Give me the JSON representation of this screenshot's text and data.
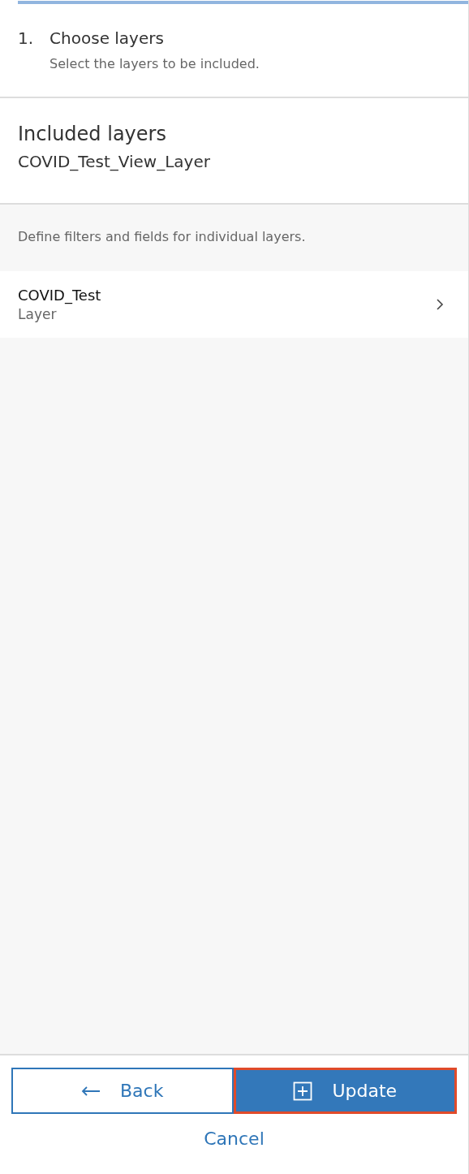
{
  "step": {
    "number": "1.",
    "title": "Choose layers",
    "subtitle": "Select the layers to be included."
  },
  "included": {
    "title": "Included layers",
    "value": "COVID_Test_View_Layer"
  },
  "layers_section": {
    "description": "Define filters and fields for individual layers.",
    "items": [
      {
        "name": "COVID_Test",
        "type": "Layer"
      }
    ]
  },
  "footer": {
    "buttons": [
      {
        "kind": "back",
        "label": "Back",
        "focused": false
      },
      {
        "kind": "update",
        "label": "Update",
        "focused": true
      }
    ],
    "cancel": "Cancel"
  }
}
